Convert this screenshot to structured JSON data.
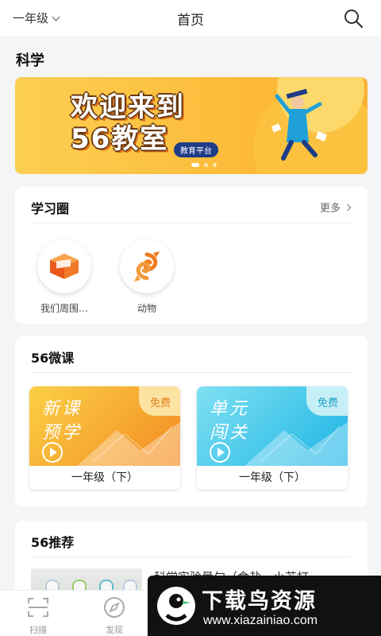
{
  "header": {
    "grade": "一年级",
    "title": "首页"
  },
  "subject": "科学",
  "banner": {
    "line1": "欢迎来到",
    "line2": "56教室",
    "badge": "教育平台",
    "dots": 3
  },
  "study_circle": {
    "title": "学习圈",
    "more": "更多",
    "items": [
      {
        "label": "我们周围…",
        "icon": "cube-icon"
      },
      {
        "label": "动物",
        "icon": "fish-icon"
      }
    ]
  },
  "micro_course": {
    "title": "56微课",
    "tiles": [
      {
        "line1": "新课",
        "line2": "预学",
        "badge": "免费",
        "grade": "一年级（下）"
      },
      {
        "line1": "单元",
        "line2": "闯关",
        "badge": "免费",
        "grade": "一年级（下）"
      }
    ]
  },
  "recommend": {
    "title": "56推荐",
    "item_title": "科学实验量勺（食盐、小苏打"
  },
  "bottom_nav": [
    {
      "label": "扫描",
      "icon": "scan-icon"
    },
    {
      "label": "发现",
      "icon": "compass-icon"
    }
  ],
  "watermark": {
    "name": "下载鸟资源",
    "url": "www.xiazainiao.com"
  },
  "colors": {
    "accent_orange": "#f38b22",
    "accent_blue": "#1eb5e6",
    "banner_yellow": "#fdbc3b"
  }
}
